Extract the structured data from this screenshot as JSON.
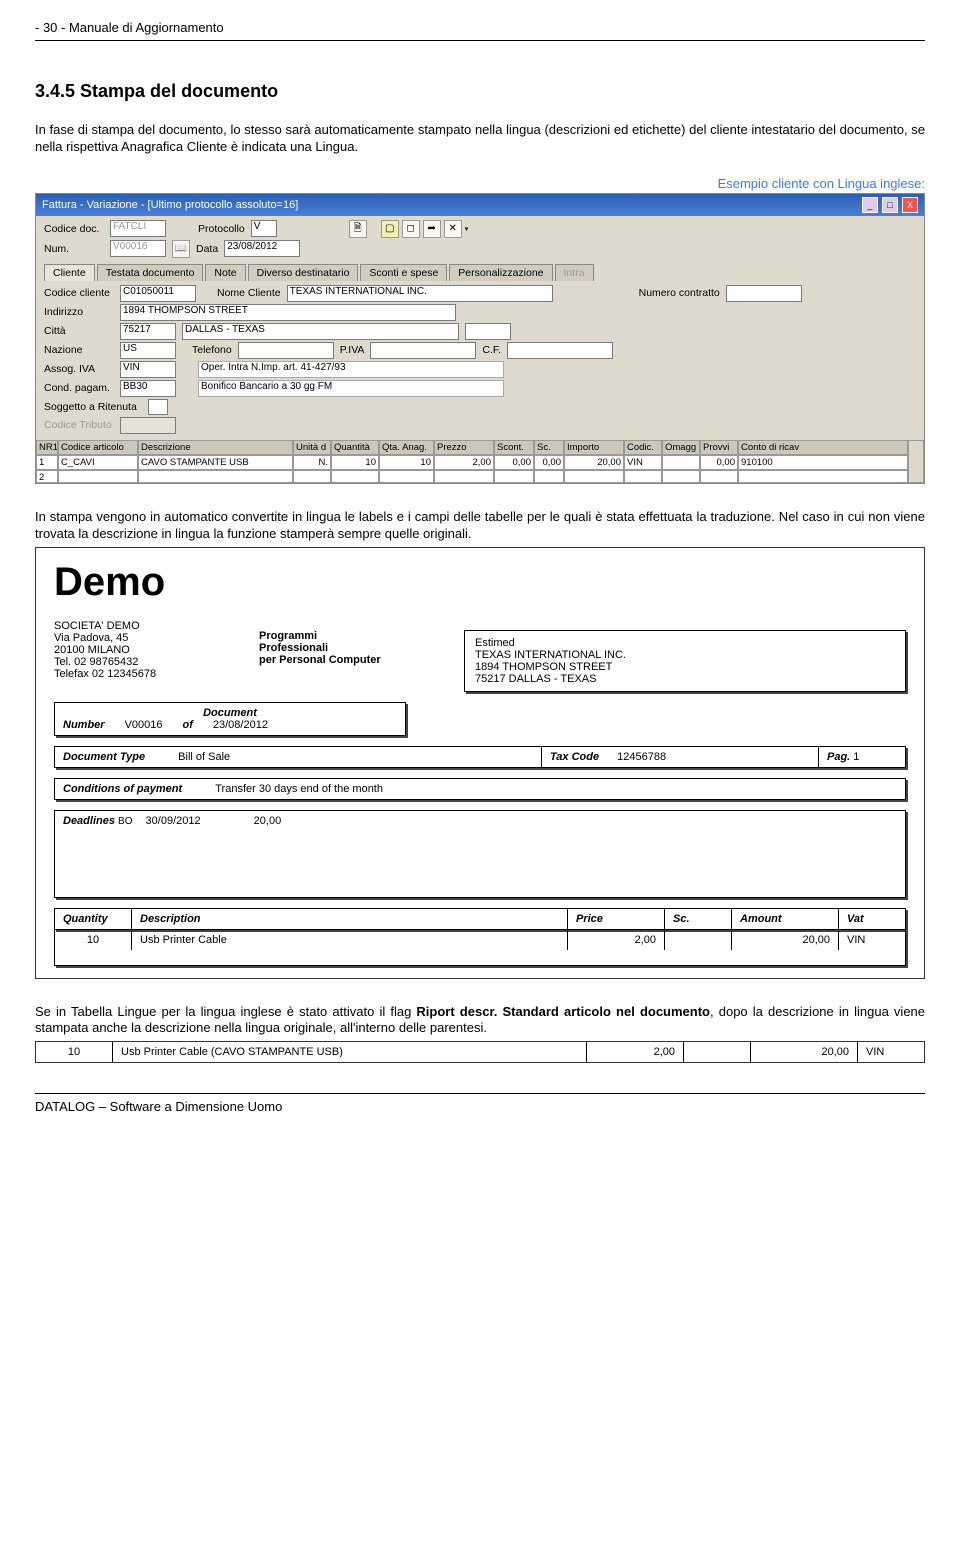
{
  "header": "- 30 -  Manuale di Aggiornamento",
  "sectionTitle": "3.4.5  Stampa del documento",
  "para1": "In fase di stampa del documento, lo stesso sarà automaticamente stampato nella lingua (descrizioni ed etichette) del cliente intestatario del documento, se nella rispettiva Anagrafica Cliente è indicata una Lingua.",
  "exampleLabel": "Esempio cliente con Lingua inglese:",
  "window": {
    "title": "Fattura - Variazione - [Ultimo protocollo assoluto=16]",
    "labels": {
      "codicedoc": "Codice doc.",
      "protocollo": "Protocollo",
      "num": "Num.",
      "data": "Data",
      "cliente": "Cliente",
      "testata": "Testata documento",
      "note": "Note",
      "diverso": "Diverso destinatario",
      "sconti": "Sconti e spese",
      "pers": "Personalizzazione",
      "intra": "Intra",
      "codicecliente": "Codice cliente",
      "nomecliente": "Nome Cliente",
      "numcontratto": "Numero contratto",
      "indirizzo": "Indirizzo",
      "citta": "Città",
      "nazione": "Nazione",
      "telefono": "Telefono",
      "piva": "P.IVA",
      "cf": "C.F.",
      "assog": "Assog. IVA",
      "oper": "Oper. Intra N.Imp. art. 41-427/93",
      "condpagam": "Cond. pagam.",
      "bonifico": "Bonifico Bancario a 30 gg FM",
      "soggetto": "Soggetto a Ritenuta",
      "codtributo": "Codice Tributo"
    },
    "values": {
      "codicedoc": "FATCLI",
      "protocollo": "V",
      "num": "V00016",
      "data": "23/08/2012",
      "codicecliente": "C01050011",
      "nomecliente": "TEXAS INTERNATIONAL INC.",
      "indirizzo": "1894 THOMPSON STREET",
      "citta_cap": "75217",
      "citta_txt": "DALLAS - TEXAS",
      "nazione": "US",
      "assog": "VIN",
      "condpagam": "BB30"
    },
    "grid": {
      "headers": [
        "NR1",
        "Codice articolo",
        "Descrizione",
        "Unità d",
        "Quantità",
        "Qta. Anag.",
        "Prezzo",
        "Scont.",
        "Sc.",
        "Importo",
        "Codic.",
        "Omagg",
        "Provvi",
        "Conto di ricav"
      ],
      "row1": [
        "1",
        "C_CAVI",
        "CAVO STAMPANTE USB",
        "N.",
        "10",
        "10",
        "2,00",
        "0,00",
        "0,00",
        "20,00",
        "VIN",
        "",
        "0,00",
        "910100"
      ],
      "row2": [
        "2",
        "",
        "",
        "",
        "",
        "",
        "",
        "",
        "",
        "",
        "",
        "",
        "",
        ""
      ]
    }
  },
  "para2": "In stampa vengono in automatico convertite in lingua le labels e i campi delle tabelle per le quali è stata effettuata la traduzione. Nel caso in cui  non viene trovata la descrizione in lingua la funzione stamperà sempre quelle originali.",
  "demo": {
    "title": "Demo",
    "company": {
      "name": "SOCIETA' DEMO",
      "addr": "Via Padova, 45",
      "city": "20100 MILANO",
      "tel": "Tel. 02 98765432",
      "fax": "Telefax 02 12345678"
    },
    "prog": {
      "l1": "Programmi",
      "l2": "Professionali",
      "l3": "per Personal Computer"
    },
    "client": {
      "l1": "Estimed",
      "l2": "TEXAS INTERNATIONAL INC.",
      "l3": "1894 THOMPSON STREET",
      "l4": "75217     DALLAS - TEXAS"
    },
    "docrow": {
      "number_lbl": "Number",
      "number": "V00016",
      "of_lbl": "of",
      "date": "23/08/2012",
      "document_lbl": "Document"
    },
    "doctype": {
      "lbl": "Document Type",
      "val": "Bill of Sale",
      "taxlbl": "Tax Code",
      "taxval": "12456788",
      "paglbl": "Pag.",
      "pagval": "1"
    },
    "cond": {
      "lbl": "Conditions of payment",
      "val": "Transfer 30  days end of the month"
    },
    "dead": {
      "lbl": "Deadlines",
      "code": "BO",
      "date": "30/09/2012",
      "amt": "20,00"
    },
    "tbl": {
      "qty": "Quantity",
      "desc": "Description",
      "price": "Price",
      "sc": "Sc.",
      "amt": "Amount",
      "vat": "Vat"
    },
    "item": {
      "qty": "10",
      "desc": "Usb Printer Cable",
      "price": "2,00",
      "sc": "",
      "amt": "20,00",
      "vat": "VIN"
    }
  },
  "para3a": "Se in Tabella Lingue per la lingua inglese è stato attivato il flag ",
  "para3b": "Riport descr. Standard articolo nel documento",
  "para3c": ", dopo la descrizione in lingua viene stampata anche la descrizione nella lingua originale, all'interno delle parentesi.",
  "item2": {
    "qty": "10",
    "desc": "Usb Printer Cable (CAVO STAMPANTE USB)",
    "price": "2,00",
    "amt": "20,00",
    "vat": "VIN"
  },
  "footer": "DATALOG – Software a Dimensione Uomo"
}
